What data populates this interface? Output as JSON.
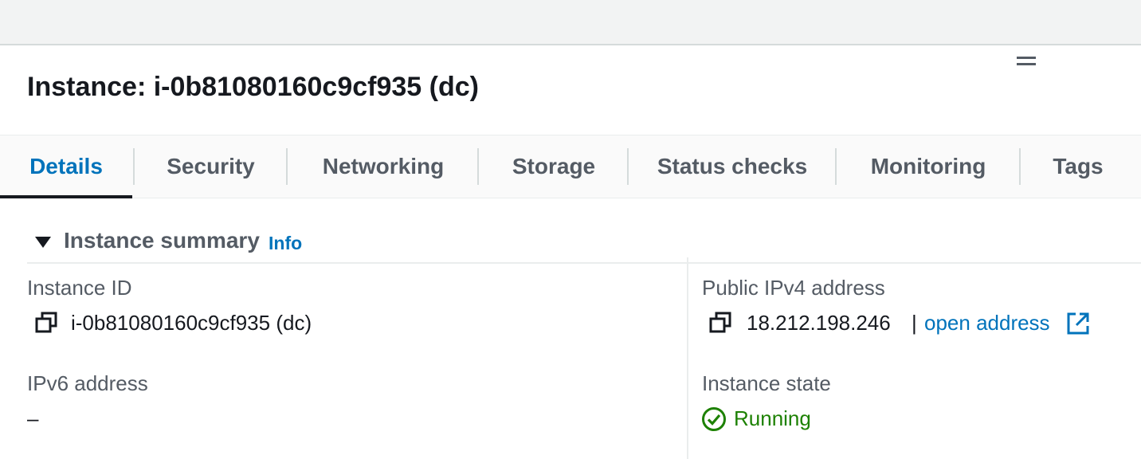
{
  "header": {
    "title": "Instance: i-0b81080160c9cf935 (dc)"
  },
  "tabs": [
    {
      "label": "Details",
      "active": true
    },
    {
      "label": "Security",
      "active": false
    },
    {
      "label": "Networking",
      "active": false
    },
    {
      "label": "Storage",
      "active": false
    },
    {
      "label": "Status checks",
      "active": false
    },
    {
      "label": "Monitoring",
      "active": false
    },
    {
      "label": "Tags",
      "active": false
    }
  ],
  "summary": {
    "title": "Instance summary",
    "info_label": "Info",
    "instance_id": {
      "label": "Instance ID",
      "value": "i-0b81080160c9cf935 (dc)"
    },
    "ipv6": {
      "label": "IPv6 address",
      "value": "–"
    },
    "public_ipv4": {
      "label": "Public IPv4 address",
      "value": "18.212.198.246",
      "separator": "|",
      "link_label": "open address"
    },
    "instance_state": {
      "label": "Instance state",
      "value": "Running"
    }
  },
  "colors": {
    "link": "#0073bb",
    "running": "#1d8102",
    "tab_inactive": "#545b64",
    "text": "#16191f"
  },
  "icons": [
    "drag-handle-icon",
    "caret-down-icon",
    "copy-icon",
    "external-link-icon",
    "check-circle-icon"
  ]
}
